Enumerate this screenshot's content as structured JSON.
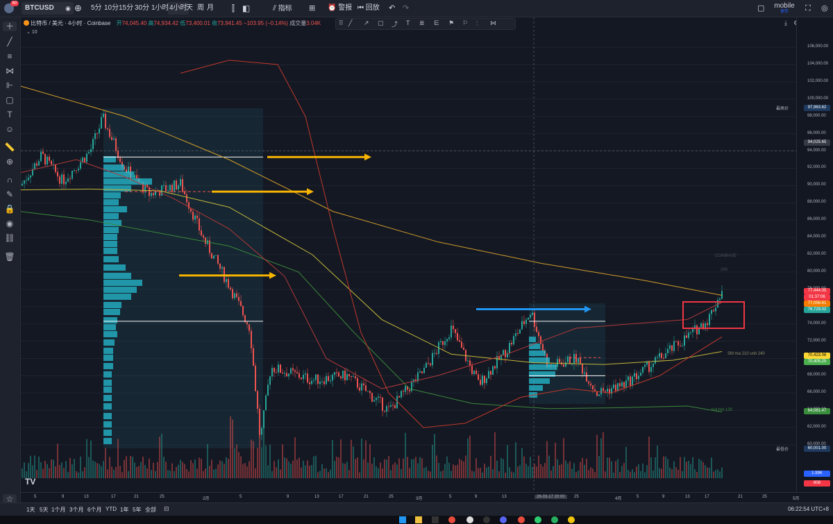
{
  "topbar": {
    "symbol": "BTCUSD",
    "notif_count": "60",
    "intervals": [
      "5分",
      "10分",
      "15分",
      "30分",
      "1小时",
      "4小时",
      "天",
      "周",
      "月"
    ],
    "indicators_label": "指标",
    "alert_label": "警报",
    "replay_label": "回放",
    "mobile_label": "mobile",
    "save_label": "保存"
  },
  "legend": {
    "title": "比特币 / 美元 · 4小时 · Coinbase",
    "open_label": "开",
    "open": "74,045.40",
    "high_label": "高",
    "high": "74,934.42",
    "low_label": "低",
    "low": "73,400.01",
    "close_label": "收",
    "close": "73,941.45",
    "change": "−103.95 (−0.14%)",
    "volume_label": "成交量",
    "volume": "3.04K",
    "sub": "10"
  },
  "price_scale": {
    "ticks": [
      "106,000.00",
      "104,000.00",
      "102,000.00",
      "100,000.00",
      "98,000.00",
      "96,000.00",
      "94,000.00",
      "92,000.00",
      "90,000.00",
      "88,000.00",
      "86,000.00",
      "84,000.00",
      "82,000.00",
      "80,000.00",
      "78,000.00",
      "76,000.00",
      "74,000.00",
      "72,000.00",
      "70,000.00",
      "68,000.00",
      "66,000.00",
      "64,000.00",
      "62,000.00",
      "60,000.00"
    ],
    "high_label": "最高价",
    "high_value": "97,963.62",
    "crosshair_value": "94,025.65",
    "price_badge": "77,444.05",
    "countdown": "01:37:06",
    "badge_orange": "77,056.61",
    "badge_green": "76,729.02",
    "badge_yellow": "70,423.06",
    "badge_green2": "70,405.25",
    "badge_green3": "64,081.47",
    "low_label": "最低价",
    "low_value": "60,001.00",
    "vol_badge": "1.99K",
    "vol_badge2": "808"
  },
  "time_axis": {
    "labels": [
      "5",
      "9",
      "13",
      "17",
      "21",
      "25",
      "2月",
      "5",
      "9",
      "13",
      "17",
      "21",
      "25",
      "3月",
      "5",
      "9",
      "13",
      "26-03-17  20:00",
      "25",
      "4月",
      "5",
      "9",
      "13",
      "17",
      "21",
      "25",
      "5月"
    ]
  },
  "bottombar": {
    "ranges": [
      "1天",
      "5天",
      "1个月",
      "3个月",
      "6个月",
      "YTD",
      "1年",
      "5年",
      "全部"
    ],
    "clock": "06:22:54 UTC+8"
  },
  "annotations": {
    "ma_label": "SM ma 210 unit 240",
    "ma2_label": "bot hm 120",
    "coinbase_label": "COINBASE",
    "d_label": "240"
  },
  "colors": {
    "bull": "#26a69a",
    "bear": "#ef5350",
    "accent": "#2962ff",
    "arrow_orange": "#f7b500",
    "arrow_blue": "#2196f3",
    "ma_orange": "#d4a02a"
  }
}
